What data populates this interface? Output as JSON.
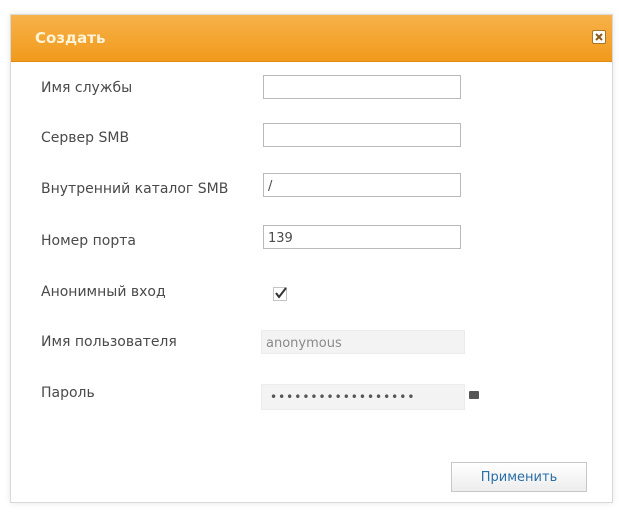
{
  "dialog": {
    "title": "Создать",
    "accent_color": "#f19a1c"
  },
  "form": {
    "service_name_label": "Имя службы",
    "service_name_value": "",
    "smb_server_label": "Сервер SMB",
    "smb_server_value": "",
    "internal_dir_label": "Внутренний каталог SMB",
    "internal_dir_value": "/",
    "port_label": "Номер порта",
    "port_value": "139",
    "anonymous_label": "Анонимный вход",
    "anonymous_checked": true,
    "username_label": "Имя пользователя",
    "username_value": "anonymous",
    "password_label": "Пароль",
    "password_value": "••••••••••••••••••"
  },
  "actions": {
    "apply_label": "Применить"
  }
}
